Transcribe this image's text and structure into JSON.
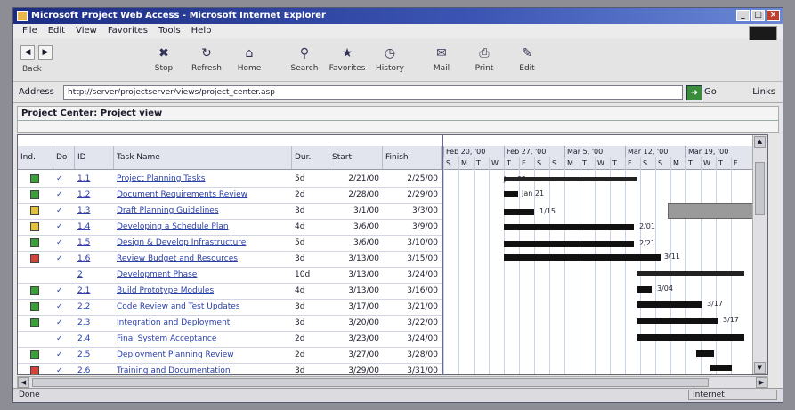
{
  "window": {
    "title": "Microsoft Project Web Access - Microsoft Internet Explorer",
    "controls": [
      "_",
      "□",
      "×"
    ]
  },
  "menu": [
    "File",
    "Edit",
    "View",
    "Favorites",
    "Tools",
    "Help"
  ],
  "toolbar": {
    "caption": "Back",
    "buttons": [
      {
        "label": "Stop",
        "icon": "stop-icon"
      },
      {
        "label": "Refresh",
        "icon": "refresh-icon"
      },
      {
        "label": "Home",
        "icon": "home-icon"
      },
      {
        "label": "Search",
        "icon": "search-icon"
      },
      {
        "label": "Favorites",
        "icon": "favorites-icon"
      },
      {
        "label": "History",
        "icon": "history-icon"
      },
      {
        "label": "Mail",
        "icon": "mail-icon"
      },
      {
        "label": "Print",
        "icon": "print-icon"
      },
      {
        "label": "Edit",
        "icon": "edit-icon"
      }
    ]
  },
  "address": {
    "label": "Address",
    "value": "http://server/projectserver/views/project_center.asp",
    "go": "Go",
    "links": "Links"
  },
  "view": {
    "title": "Project Center: Project view"
  },
  "grid": {
    "headers": [
      "Ind.",
      "Do",
      "ID",
      "Task Name",
      "Dur.",
      "Start",
      "Finish"
    ],
    "rows": [
      {
        "status": "green",
        "check": "✓",
        "id": "1.1",
        "name": "Project Planning Tasks",
        "dur": "5d",
        "start": "2/21/00",
        "finish": "2/25/00"
      },
      {
        "status": "green",
        "check": "✓",
        "id": "1.2",
        "name": "Document Requirements Review",
        "dur": "2d",
        "start": "2/28/00",
        "finish": "2/29/00"
      },
      {
        "status": "yellow",
        "check": "✓",
        "id": "1.3",
        "name": "Draft Planning Guidelines",
        "dur": "3d",
        "start": "3/1/00",
        "finish": "3/3/00"
      },
      {
        "status": "yellow",
        "check": "✓",
        "id": "1.4",
        "name": "Developing a Schedule Plan",
        "dur": "4d",
        "start": "3/6/00",
        "finish": "3/9/00"
      },
      {
        "status": "green",
        "check": "✓",
        "id": "1.5",
        "name": "Design & Develop Infrastructure",
        "dur": "5d",
        "start": "3/6/00",
        "finish": "3/10/00"
      },
      {
        "status": "red",
        "check": "✓",
        "id": "1.6",
        "name": "Review Budget and Resources",
        "dur": "3d",
        "start": "3/13/00",
        "finish": "3/15/00"
      },
      {
        "status": "",
        "check": "",
        "id": "2",
        "name": "Development Phase",
        "dur": "10d",
        "start": "3/13/00",
        "finish": "3/24/00"
      },
      {
        "status": "green",
        "check": "✓",
        "id": "2.1",
        "name": "Build Prototype Modules",
        "dur": "4d",
        "start": "3/13/00",
        "finish": "3/16/00"
      },
      {
        "status": "green",
        "check": "✓",
        "id": "2.2",
        "name": "Code Review and Test Updates",
        "dur": "3d",
        "start": "3/17/00",
        "finish": "3/21/00"
      },
      {
        "status": "green",
        "check": "✓",
        "id": "2.3",
        "name": "Integration and Deployment",
        "dur": "3d",
        "start": "3/20/00",
        "finish": "3/22/00"
      },
      {
        "status": "",
        "check": "✓",
        "id": "2.4",
        "name": "Final System Acceptance",
        "dur": "2d",
        "start": "3/23/00",
        "finish": "3/24/00"
      },
      {
        "status": "green",
        "check": "✓",
        "id": "2.5",
        "name": "Deployment Planning Review",
        "dur": "2d",
        "start": "3/27/00",
        "finish": "3/28/00"
      },
      {
        "status": "red",
        "check": "✓",
        "id": "2.6",
        "name": "Training and Documentation",
        "dur": "3d",
        "start": "3/29/00",
        "finish": "3/31/00"
      }
    ]
  },
  "gantt": {
    "weeks": [
      "Feb 20, '00",
      "Feb 27, '00",
      "Mar 5, '00",
      "Mar 12, '00",
      "Mar 19, '00"
    ],
    "days": [
      "S",
      "M",
      "T",
      "W",
      "T",
      "F",
      "S",
      "S",
      "M",
      "T",
      "W",
      "T",
      "F",
      "S",
      "S",
      "M",
      "T",
      "W",
      "T",
      "F"
    ],
    "bar_labels": [
      "Jan 02",
      "Jan 21",
      "1/15",
      "2/01",
      "2/21",
      "3/11",
      "3/04",
      "3/17",
      "3/17"
    ]
  },
  "status": {
    "text": "Done",
    "zone": "Internet"
  },
  "colors": {
    "titlebar": "#1c2c82",
    "status_green": "#3aa13a",
    "status_yellow": "#e2c23a",
    "status_red": "#d8423a",
    "link": "#2a3ea8"
  }
}
